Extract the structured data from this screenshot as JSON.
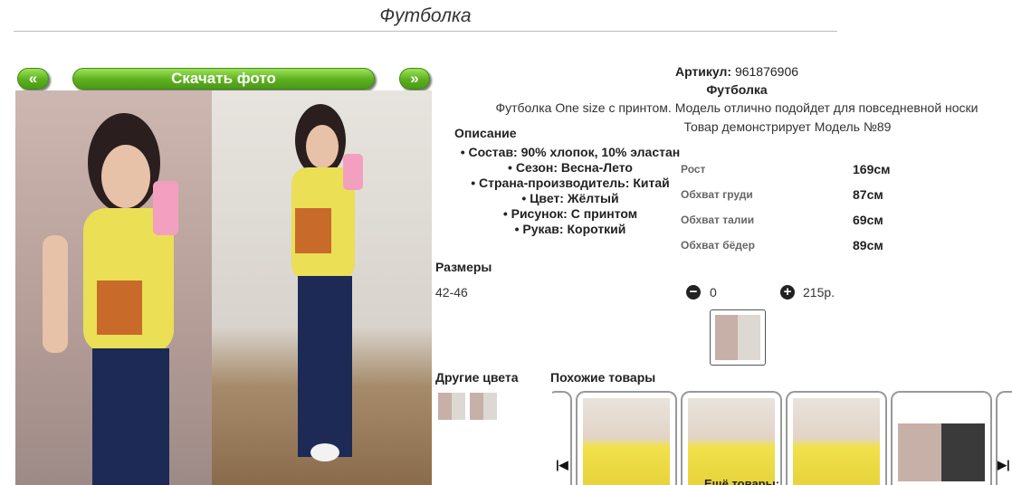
{
  "page": {
    "title": "Футболка"
  },
  "gallery": {
    "prev_label": "«",
    "download_label": "Скачать фото",
    "next_label": "»"
  },
  "product": {
    "article_label": "Артикул:",
    "article_value": "961876906",
    "name": "Футболка",
    "summary": "Футболка One size с принтом. Модель отлично подойдет для повседневной носки",
    "model_note": "Товар демонстрирует Модель №89"
  },
  "description": {
    "title": "Описание",
    "items": [
      "Состав: 90% хлопок, 10% эластан",
      "Сезон: Весна-Лето",
      "Страна-производитель: Китай",
      "Цвет: Жёлтый",
      "Рисунок: С принтом",
      "Рукав: Короткий"
    ]
  },
  "measurements": [
    {
      "label": "Рост",
      "value": "169см"
    },
    {
      "label": "Обхват груди",
      "value": "87см"
    },
    {
      "label": "Обхват талии",
      "value": "69см"
    },
    {
      "label": "Обхват бёдер",
      "value": "89см"
    }
  ],
  "sizes": {
    "title": "Размеры",
    "size": "42-46",
    "quantity": "0",
    "price": "215р.",
    "minus_icon": "minus-circle-icon",
    "plus_icon": "plus-circle-icon"
  },
  "other_colors": {
    "title": "Другие цвета"
  },
  "similar": {
    "title": "Похожие товары",
    "more_label": "Ещё товары:"
  }
}
